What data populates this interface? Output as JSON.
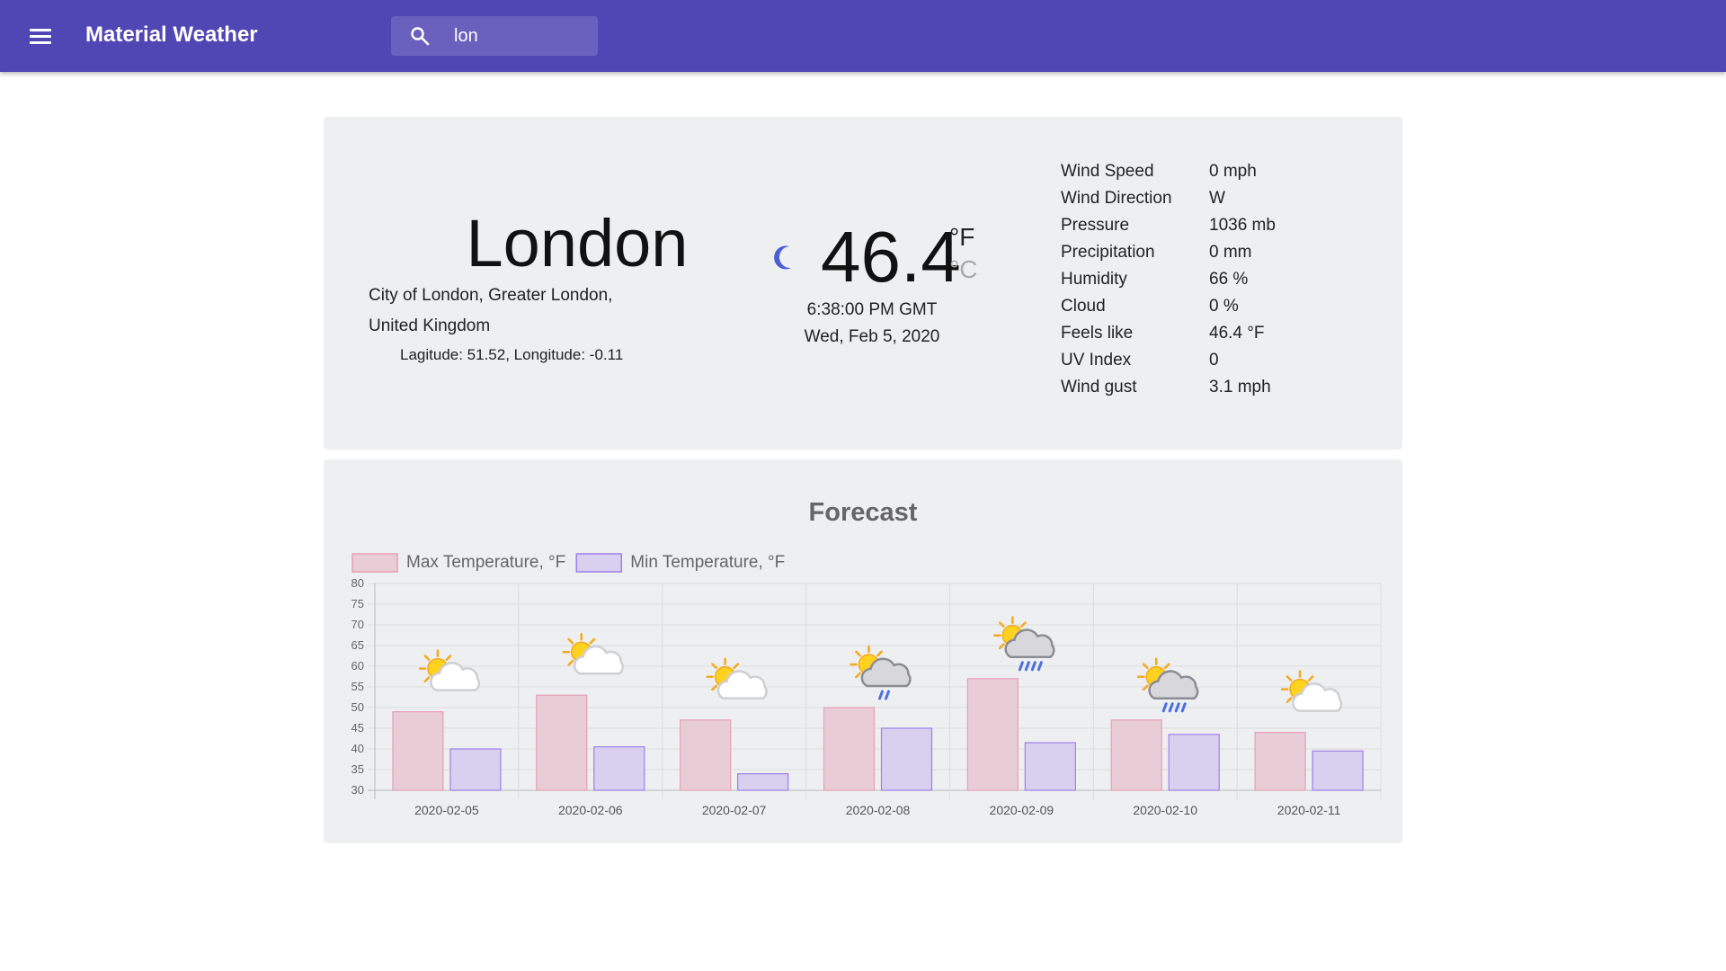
{
  "appbar": {
    "title": "Material Weather",
    "search_value": "lon",
    "menu_icon": "menu-icon",
    "search_icon": "search-icon",
    "color": "#5046b4"
  },
  "current": {
    "city": "London",
    "location_line1": "City of London, Greater London,",
    "location_line2": "United Kingdom",
    "coordinates": "Lagitude: 51.52, Longitude: -0.11",
    "condition_icon": "moon-icon",
    "temperature": "46.4",
    "unit_f": "°F",
    "unit_c": "°C",
    "time": "6:38:00 PM GMT",
    "date": "Wed, Feb 5, 2020",
    "details": [
      {
        "label": "Wind Speed",
        "value": "0 mph"
      },
      {
        "label": "Wind Direction",
        "value": "W"
      },
      {
        "label": "Pressure",
        "value": "1036 mb"
      },
      {
        "label": "Precipitation",
        "value": "0 mm"
      },
      {
        "label": "Humidity",
        "value": "66 %"
      },
      {
        "label": "Cloud",
        "value": "0 %"
      },
      {
        "label": "Feels like",
        "value": "46.4 °F"
      },
      {
        "label": "UV Index",
        "value": "0"
      },
      {
        "label": "Wind gust",
        "value": "3.1 mph"
      }
    ]
  },
  "forecast": {
    "title": "Forecast"
  },
  "chart_data": {
    "type": "bar",
    "categories": [
      "2020-02-05",
      "2020-02-06",
      "2020-02-07",
      "2020-02-08",
      "2020-02-09",
      "2020-02-10",
      "2020-02-11"
    ],
    "series": [
      {
        "name": "Max Temperature, °F",
        "values": [
          49,
          53,
          47,
          50,
          57,
          47,
          44
        ],
        "fill": "#e8ccd6",
        "stroke": "#e8a0b4"
      },
      {
        "name": "Min Temperature, °F",
        "values": [
          40,
          40.5,
          34,
          45,
          41.5,
          43.5,
          39.5
        ],
        "fill": "#d9d0f0",
        "stroke": "#9f7fe8"
      }
    ],
    "icons": [
      "partly-cloudy-icon",
      "partly-cloudy-icon",
      "partly-cloudy-icon",
      "light-rain-icon",
      "moderate-rain-icon",
      "moderate-rain-icon",
      "partly-cloudy-icon"
    ],
    "ylim": [
      30,
      80
    ],
    "yticks": [
      30,
      35,
      40,
      45,
      50,
      55,
      60,
      65,
      70,
      75,
      80
    ],
    "grid": true,
    "legend": "top-left"
  }
}
